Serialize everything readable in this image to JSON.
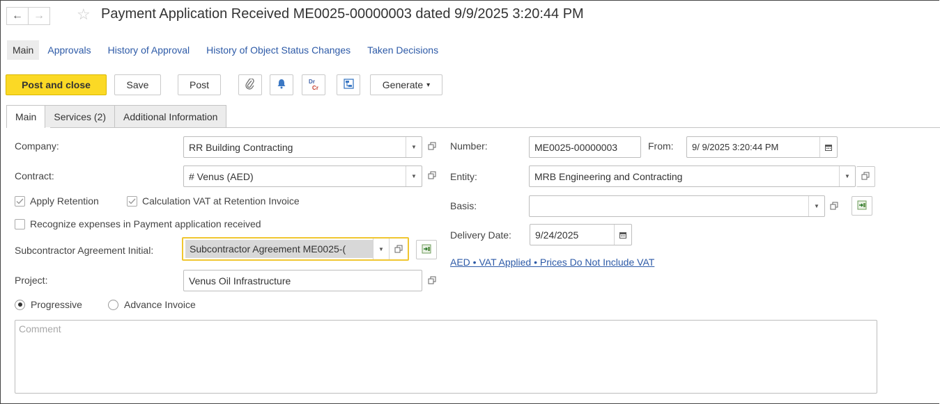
{
  "header": {
    "title": "Payment Application Received ME0025-00000003 dated 9/9/2025 3:20:44 PM"
  },
  "nav": {
    "current": "Main",
    "links": [
      "Approvals",
      "History of Approval",
      "History of Object Status Changes",
      "Taken Decisions"
    ]
  },
  "toolbar": {
    "post_and_close": "Post and close",
    "save": "Save",
    "post": "Post",
    "dr": "Dr",
    "cr": "Cr",
    "generate": "Generate"
  },
  "tabs": [
    "Main",
    "Services (2)",
    "Additional Information"
  ],
  "form": {
    "company_label": "Company:",
    "company_value": "RR Building Contracting",
    "contract_label": "Contract:",
    "contract_value": "# Venus (AED)",
    "apply_retention": "Apply Retention",
    "calc_vat": "Calculation VAT at Retention Invoice",
    "recognize_expenses": "Recognize expenses in Payment application received",
    "sub_agreement_label": "Subcontractor Agreement Initial:",
    "sub_agreement_value": "Subcontractor Agreement ME0025-(",
    "project_label": "Project:",
    "project_value": "Venus Oil Infrastructure",
    "radio_progressive": "Progressive",
    "radio_advance": "Advance Invoice",
    "number_label": "Number:",
    "number_value": "ME0025-00000003",
    "from_label": "From:",
    "from_value": "9/ 9/2025  3:20:44 PM",
    "entity_label": "Entity:",
    "entity_value": "MRB Engineering and Contracting",
    "basis_label": "Basis:",
    "basis_value": "",
    "delivery_label": "Delivery Date:",
    "delivery_value": "9/24/2025",
    "vat_link": "AED • VAT Applied • Prices Do Not Include VAT",
    "comment_placeholder": "Comment"
  },
  "colors": {
    "primary_button": "#fbd925",
    "link": "#2d5aa7",
    "focus_border": "#f0c630"
  },
  "icons": [
    "back-arrow-icon",
    "forward-arrow-icon",
    "star-icon",
    "paperclip-icon",
    "bell-icon",
    "dr-cr-icon",
    "structure-icon",
    "dropdown-arrow-icon",
    "open-icon",
    "calendar-icon",
    "select-from-list-icon",
    "checkmark-icon"
  ]
}
